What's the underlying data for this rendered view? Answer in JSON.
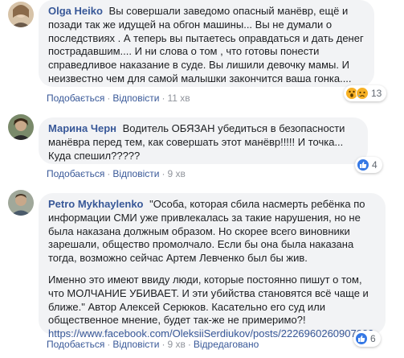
{
  "comments": [
    {
      "author": "Olga Heiko",
      "text": "Вы совершали заведомо опасный манёвр, ещё и позади так же идущей на обгон машины... Вы не думали о последствиях . А теперь вы пытаетесь оправдаться и дать денег пострадавшим.... И ни слова о том , что готовы понести справедливое наказание в суде. Вы лишили девочку мамы. И неизвестно чем для самой малышки закончится ваша гонка....",
      "like_label": "Подобається",
      "reply_label": "Відповісти",
      "time": "11 хв",
      "reaction_count": "13",
      "reaction_icons": [
        "wow-icon",
        "sad-icon"
      ]
    },
    {
      "author": "Марина Черн",
      "text": "Водитель ОБЯЗАН убедиться в безопасности манёвра перед тем, как совершать этот манёвр!!!!! И точка... Куда спешил?????",
      "like_label": "Подобається",
      "reply_label": "Відповісти",
      "time": "9 хв",
      "reaction_count": "4",
      "reaction_icons": [
        "like-icon"
      ]
    },
    {
      "author": "Petro Mykhaylenko",
      "text": "\"Особа, которая сбила насмерть ребёнка по информации СМИ уже привлекалась за такие нарушения, но не была наказана должным образом. Но скорее всего виновники зарешали, общество промолчало. Если бы она была наказана тогда, возможно сейчас Артем Левченко был бы жив.",
      "text2": "Именно это имеют ввиду люди, которые постоянно пишут о том, что МОЛЧАНИЕ УБИВАЕТ. И эти убийства становятся всё чаще и ближе.\" Автор Алексей Серюков. Касательно его суд или общественное мнение, будет так-же не примеримо?!",
      "link": "https://www.facebook.com/OleksiiSerdiukov/posts/2226960260907083",
      "like_label": "Подобається",
      "reply_label": "Відповісти",
      "time": "9 хв",
      "edited_label": "Відредаговано",
      "reaction_count": "6",
      "reaction_icons": [
        "like-icon"
      ]
    }
  ],
  "colors": {
    "link_blue": "#385898",
    "bubble_bg": "#f2f3f5",
    "like_blue": "#3578e5",
    "meta_grey": "#90949c"
  }
}
